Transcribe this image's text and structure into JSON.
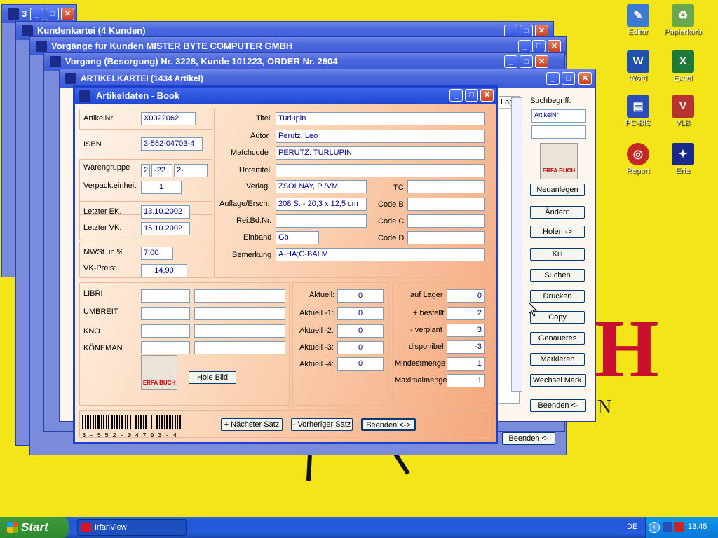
{
  "desktop": {
    "icons": [
      {
        "label": "Editor"
      },
      {
        "label": "Papierkorb"
      },
      {
        "label": "Word"
      },
      {
        "label": "Excel"
      },
      {
        "label": "PC-BIS"
      },
      {
        "label": "VLB"
      },
      {
        "label": "Report"
      },
      {
        "label": "Erfa"
      }
    ],
    "big_letter_h": "H",
    "big_letter_n": "N"
  },
  "windows": {
    "w1": {
      "title": "3"
    },
    "w2": {
      "title": "Kundenkartei    (4 Kunden)"
    },
    "w3": {
      "title": "Vorgänge für Kunden   MISTER BYTE COMPUTER GMBH"
    },
    "w4": {
      "title": "Vorgang (Besorgung) Nr. 3228, Kunde 101223,  ORDER Nr. 2804"
    },
    "w5": {
      "title": "ARTIKELKARTEI   (1434 Artikel)"
    },
    "beenden_back": "Beenden <-"
  },
  "artikelkartei": {
    "column_header": "Lag",
    "suchbegriff_label": "Suchbegriff:",
    "suchbegriff_value": "ArtikelNr",
    "buttons": [
      "Neuanlegen",
      "Ändern",
      "Holen ->",
      "Kill",
      "Suchen",
      "Drucken",
      "Copy",
      "Genaueres",
      "Markieren",
      "Wechsel Mark.",
      "Beenden <-"
    ]
  },
  "dialog": {
    "title": "Artikeldaten - Book",
    "artikelnr": {
      "label": "ArtikelNr",
      "value": "X0022062"
    },
    "isbn": {
      "label": "ISBN",
      "value": "3-552-04703-4"
    },
    "warengruppe": {
      "label": "Warengruppe",
      "v1": "2",
      "v2": "-22",
      "v3": "2-"
    },
    "verpack": {
      "label": "Verpack.einheit",
      "value": "1"
    },
    "letzter_ek": {
      "label": "Letzter EK.",
      "value": "13.10.2002"
    },
    "letzter_vk": {
      "label": "Letzter VK.",
      "value": "15.10.2002"
    },
    "mwst": {
      "label": "MWSt. in %",
      "value": "7,00"
    },
    "vkpreis": {
      "label": "VK-Preis:",
      "value": "14,90"
    },
    "titel": {
      "label": "Titel",
      "value": "Turlupin"
    },
    "autor": {
      "label": "Autor",
      "value": "Perutz, Leo"
    },
    "matchcode": {
      "label": "Matchcode",
      "value": "PERUTZ: TURLUPIN"
    },
    "untertitel": {
      "label": "Untertitel",
      "value": ""
    },
    "verlag": {
      "label": "Verlag",
      "value": "ZSOLNAY, P /VM"
    },
    "tc": {
      "label": "TC",
      "value": ""
    },
    "auflage": {
      "label": "Auflage/Ersch.",
      "value": "208 S. - 20,3 x 12,5 cm"
    },
    "codeb": {
      "label": "Code B",
      "value": ""
    },
    "reibd": {
      "label": "Rei.Bd.Nr.",
      "value": ""
    },
    "codec": {
      "label": "Code C",
      "value": ""
    },
    "einband": {
      "label": "Einband",
      "value": "Gb"
    },
    "coded": {
      "label": "Code D",
      "value": ""
    },
    "bemerkung": {
      "label": "Bemerkung",
      "value": "A-HA;C-BALM"
    },
    "suppliers": [
      {
        "label": "LIBRI"
      },
      {
        "label": "UMBREIT"
      },
      {
        "label": "KNO"
      },
      {
        "label": "KÖNEMAN"
      }
    ],
    "hole_bild": "Hole Bild",
    "aktuell": [
      {
        "label": "Aktuell:",
        "value": "0"
      },
      {
        "label": "Aktuell -1:",
        "value": "0"
      },
      {
        "label": "Aktuell -2:",
        "value": "0"
      },
      {
        "label": "Aktuell -3:",
        "value": "0"
      },
      {
        "label": "Aktuell -4:",
        "value": "0"
      }
    ],
    "stock": [
      {
        "label": "auf Lager",
        "value": "0"
      },
      {
        "label": "+ bestellt",
        "value": "2"
      },
      {
        "label": "- verplant",
        "value": "3"
      },
      {
        "label": "disponibel",
        "value": "-3"
      },
      {
        "label": "Mindestmenge",
        "value": "1"
      },
      {
        "label": "Maximalmenge",
        "value": "1"
      }
    ],
    "barcode_text": "3 - 5 5 2 - 0 4 7 0 3 - 4",
    "btn_next": "+ Nächster Satz",
    "btn_prev": "- Vorheriger Satz",
    "btn_end": "Beenden <->",
    "logo_text": "ERFA BUCH"
  },
  "taskbar": {
    "start": "Start",
    "task": "IrfanView",
    "lang": "DE",
    "clock": "13:45"
  }
}
